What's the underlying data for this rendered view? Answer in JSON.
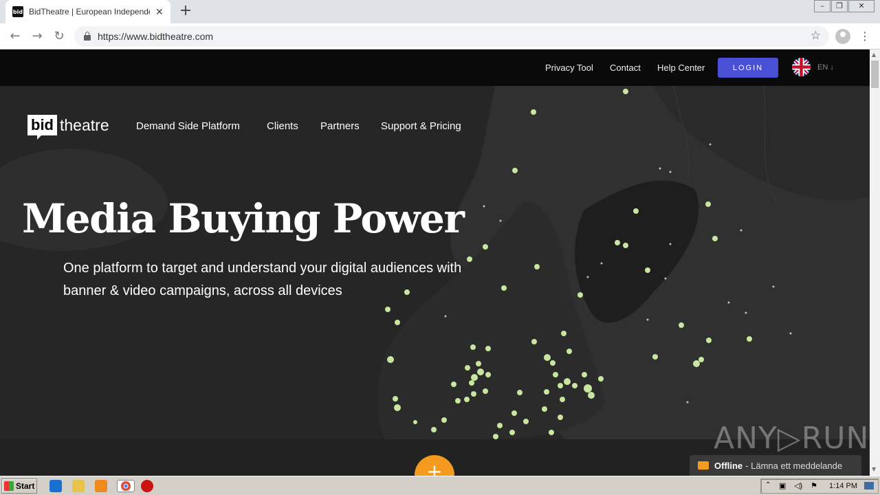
{
  "browser": {
    "tab_title": "BidTheatre | European Independent",
    "tab_favicon": "bid",
    "new_tab_symbol": "+",
    "url": "https://www.bidtheatre.com"
  },
  "topbar": {
    "links": [
      "Privacy Tool",
      "Contact",
      "Help Center"
    ],
    "login_label": "LOGIN",
    "language": "EN ↓"
  },
  "logo": {
    "box_text": "bid",
    "text": "theatre"
  },
  "main_nav": [
    "Demand Side Platform",
    "Clients",
    "Partners",
    "Support & Pricing"
  ],
  "hero": {
    "title": "Media Buying Power",
    "subtitle_line1": "One platform to target and understand your digital audiences with",
    "subtitle_line2": "banner & video campaigns, across all devices"
  },
  "fab_symbol": "+",
  "watermark": "ANY▷RUN",
  "chat": {
    "status": "Offline",
    "message": "- Lämna ett meddelande"
  },
  "taskbar": {
    "start_label": "Start",
    "clock": "1:14 PM"
  },
  "colors": {
    "login": "#4a50d6",
    "accent_orange": "#f39a1f",
    "map_dots": "#c8e6a0"
  }
}
